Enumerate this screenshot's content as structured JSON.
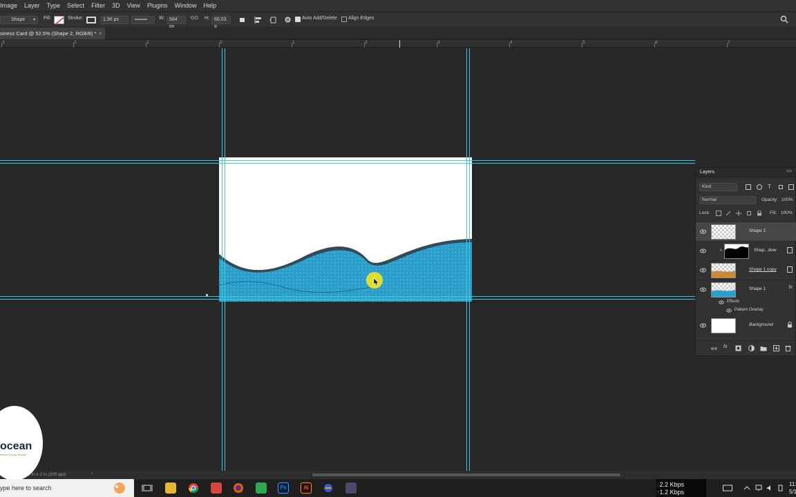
{
  "menubar": {
    "items": [
      "Image",
      "Layer",
      "Type",
      "Select",
      "Filter",
      "3D",
      "View",
      "Plugins",
      "Window",
      "Help"
    ]
  },
  "options": {
    "mode": "Shape",
    "fill_label": "Fill:",
    "stroke_label": "Stroke:",
    "stroke_size": "1.96 px",
    "w_label": "W:",
    "w_value": "584 px",
    "go_label": "GO",
    "h_label": "H:",
    "h_value": "60.03 p",
    "auto_add_delete": "Auto Add/Delete",
    "align_edges": "Align Edges"
  },
  "document": {
    "tab_title": "siness Card @ 52.5% (Shape 2, RGB/8) *",
    "close": "×"
  },
  "ruler": {
    "labels": [
      "3",
      "2",
      "1",
      "0",
      "1",
      "2",
      "3",
      "4",
      "5",
      "6",
      "7"
    ]
  },
  "layers_panel": {
    "title": "Layers",
    "filter_kind": "Kind",
    "blend_mode": "Normal",
    "opacity_label": "Opacity:",
    "opacity_value": "100%",
    "lock_label": "Lock:",
    "fill_label": "Fill:",
    "fill_value": "100%",
    "layers": [
      {
        "name": "Shape 2",
        "selected": true
      },
      {
        "name": "Shap...dow",
        "selected": false
      },
      {
        "name": "Shape 1 copy",
        "selected": false
      },
      {
        "name": "Shape 1",
        "selected": false,
        "fx": "fx"
      },
      {
        "name": "Background",
        "selected": false
      }
    ],
    "effects_label": "Effects",
    "effect_item": "Pattern Overlay"
  },
  "status": {
    "size_text": "5 in x 2 in (300 ppi)"
  },
  "taskbar": {
    "search_placeholder": "ype here to search",
    "net_down": "2.2 Kbps",
    "net_up": "1.2 Kbps",
    "clock_time": "11:",
    "clock_date": "5/1"
  },
  "logo": {
    "text": "ocean",
    "subtext": "reative Design Studio"
  },
  "colors": {
    "guide": "#3ec7e0",
    "wave_blue": "#2a9dc8",
    "panel_bg": "#323232",
    "canvas_bg": "#282828",
    "highlight": "#e8e12a"
  }
}
